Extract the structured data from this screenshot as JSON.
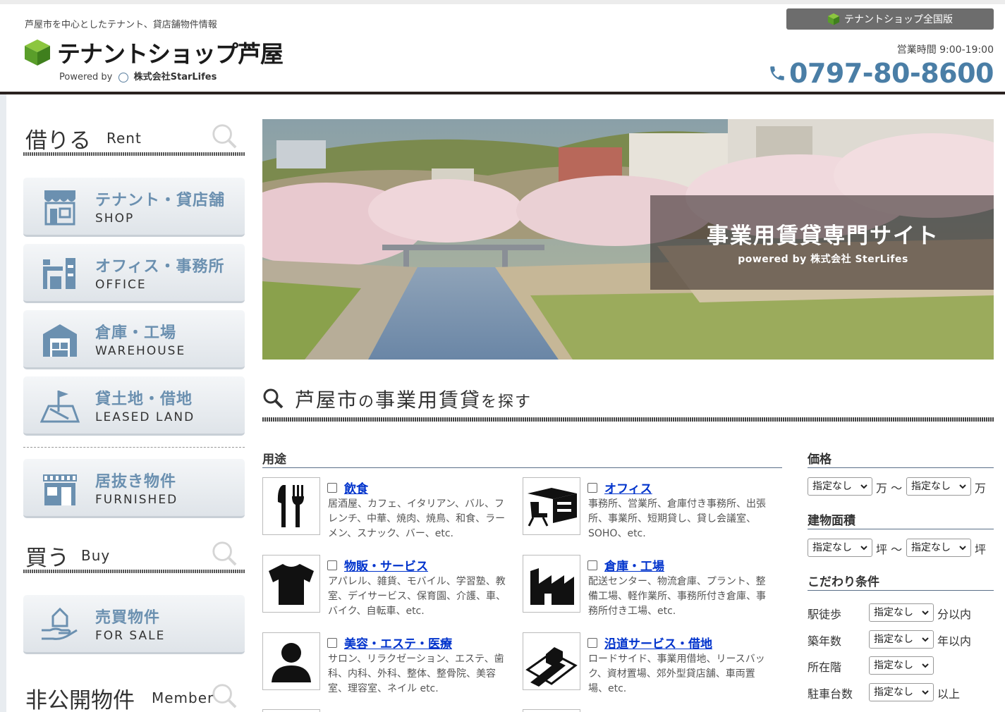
{
  "header": {
    "tagline": "芦屋市を中心としたテナント、貸店舗物件情報",
    "logo_name": "テナントショップ芦屋",
    "powered_prefix": "Powered by",
    "powered_company": "株式会社StarLifes",
    "national_button": "テナントショップ全国版",
    "hours": "営業時間 9:00-19:00",
    "phone": "0797-80-8600"
  },
  "sidebar": {
    "rent": {
      "jp": "借りる",
      "en": "Rent"
    },
    "buy": {
      "jp": "買う",
      "en": "Buy"
    },
    "member": {
      "jp": "非公開物件",
      "en": "Member"
    },
    "items": [
      {
        "jp": "テナント・貸店舗",
        "en": "SHOP",
        "icon": "shop-icon"
      },
      {
        "jp": "オフィス・事務所",
        "en": "OFFICE",
        "icon": "office-icon"
      },
      {
        "jp": "倉庫・工場",
        "en": "WAREHOUSE",
        "icon": "warehouse-icon"
      },
      {
        "jp": "貸土地・借地",
        "en": "LEASED LAND",
        "icon": "land-icon"
      },
      {
        "jp": "居抜き物件",
        "en": "FURNISHED",
        "icon": "furnished-icon"
      },
      {
        "jp": "売買物件",
        "en": "FOR SALE",
        "icon": "sale-icon"
      }
    ]
  },
  "hero": {
    "title": "事業用賃貸専門サイト",
    "subtitle": "powered by 株式会社 SterLifes"
  },
  "search": {
    "place": "芦屋市",
    "no": "の",
    "kind": "事業用賃貸",
    "wo": "を探す"
  },
  "purpose": {
    "label": "用途",
    "items": [
      {
        "name": "飲食",
        "desc": "居酒屋、カフェ、イタリアン、バル、フレンチ、中華、焼肉、焼鳥、和食、ラーメン、スナック、バー、etc."
      },
      {
        "name": "オフィス",
        "desc": "事務所、営業所、倉庫付き事務所、出張所、事業所、短期貸し、貸し会議室、SOHO、etc."
      },
      {
        "name": "物販・サービス",
        "desc": "アパレル、雑貨、モバイル、学習塾、教室、デイサービス、保育園、介護、車、バイク、自転車、etc."
      },
      {
        "name": "倉庫・工場",
        "desc": "配送センター、物流倉庫、プラント、整備工場、軽作業所、事務所付き倉庫、事務所付き工場、etc."
      },
      {
        "name": "美容・エステ・医療",
        "desc": "サロン、リラクゼーション、エステ、歯科、内科、外科、整体、整骨院、美容室、理容室、ネイル etc."
      },
      {
        "name": "沿道サービス・借地",
        "desc": "ロードサイド、事業用借地、リースバック、資材置場、郊外型貸店舗、車両置場、etc."
      }
    ]
  },
  "filters": {
    "price_label": "価格",
    "area_label": "建物面積",
    "cond_label": "こだわり条件",
    "unspecified": "指定なし",
    "man": "万",
    "tsubo": "坪",
    "tilde": "〜",
    "rows": [
      {
        "label": "駅徒歩",
        "unit": "分以内"
      },
      {
        "label": "築年数",
        "unit": "年以内"
      },
      {
        "label": "所在階",
        "unit": ""
      },
      {
        "label": "駐車台数",
        "unit": "以上"
      }
    ]
  },
  "colors": {
    "accent_blue": "#6b90b0",
    "phone_blue": "#4a7ea6",
    "link_blue": "#0033cc",
    "logo_green": "#5fae2e"
  }
}
